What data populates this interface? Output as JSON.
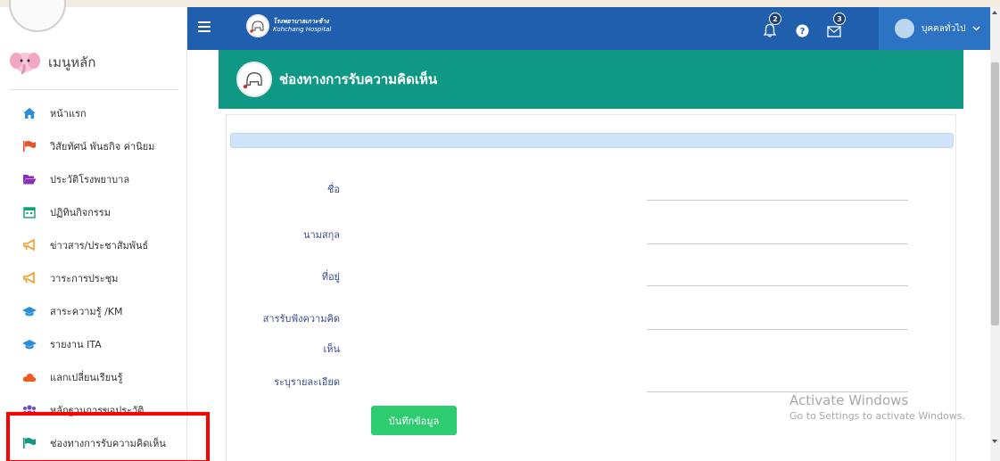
{
  "sidebar": {
    "menu_title": "เมนูหลัก",
    "items": [
      {
        "label": "หน้าแรก",
        "icon": "home-icon",
        "color": "#2a8fd6"
      },
      {
        "label": "วิสัยทัศน์ พันธกิจ ค่านิยม",
        "icon": "flag-icon",
        "color": "#e8542c"
      },
      {
        "label": "ประวัติโรงพยาบาล",
        "icon": "folder-open-icon",
        "color": "#8a2fb3"
      },
      {
        "label": "ปฏิทินกิจกรรม",
        "icon": "calendar-icon",
        "color": "#11a36f"
      },
      {
        "label": "ข่าวสาร/ประชาสัมพันธ์",
        "icon": "megaphone-icon",
        "color": "#f39b1b"
      },
      {
        "label": "วาระการประชุม",
        "icon": "megaphone-icon",
        "color": "#f39b1b"
      },
      {
        "label": "สาระความรู้ /KM",
        "icon": "graduation-cap-icon",
        "color": "#2a8fd6"
      },
      {
        "label": "รายงาน ITA",
        "icon": "graduation-cap-icon",
        "color": "#2a8fd6"
      },
      {
        "label": "แลกเปลี่ยนเรียนรู้",
        "icon": "cloud-icon",
        "color": "#f05a22"
      },
      {
        "label": "หลักฐานการขอประวัติ",
        "icon": "users-icon",
        "color": "#6b4fc6"
      },
      {
        "label": "ช่องทางการรับความคิดเห็น",
        "icon": "flag-icon",
        "color": "#0f9884"
      }
    ]
  },
  "topnav": {
    "brand_line1": "โรงพยาบาลเกาะช้าง",
    "brand_line2": "Kohchang Hospital",
    "notifications_count": "2",
    "messages_count": "3",
    "help_icon": "question-circle-icon",
    "user_label": "บุคคลทั่วไป"
  },
  "page": {
    "title": "ช่องทางการรับความคิดเห็น",
    "fields": {
      "first_name": "ชื่อ",
      "last_name": "นามสกุล",
      "address": "ที่อยู่",
      "channel_line1": "สารรับฟังความคิด",
      "channel_line2": "เห็น",
      "details": "ระบุรายละเอียด"
    },
    "save_button": "บันทึกข้อมูล"
  },
  "watermark": {
    "line1": "Activate Windows",
    "line2": "Go to Settings to activate Windows."
  },
  "colors": {
    "topnav": "#1f5fad",
    "panel_header": "#0f9884",
    "save_button": "#2ecc71",
    "highlight": "#ff0000"
  }
}
